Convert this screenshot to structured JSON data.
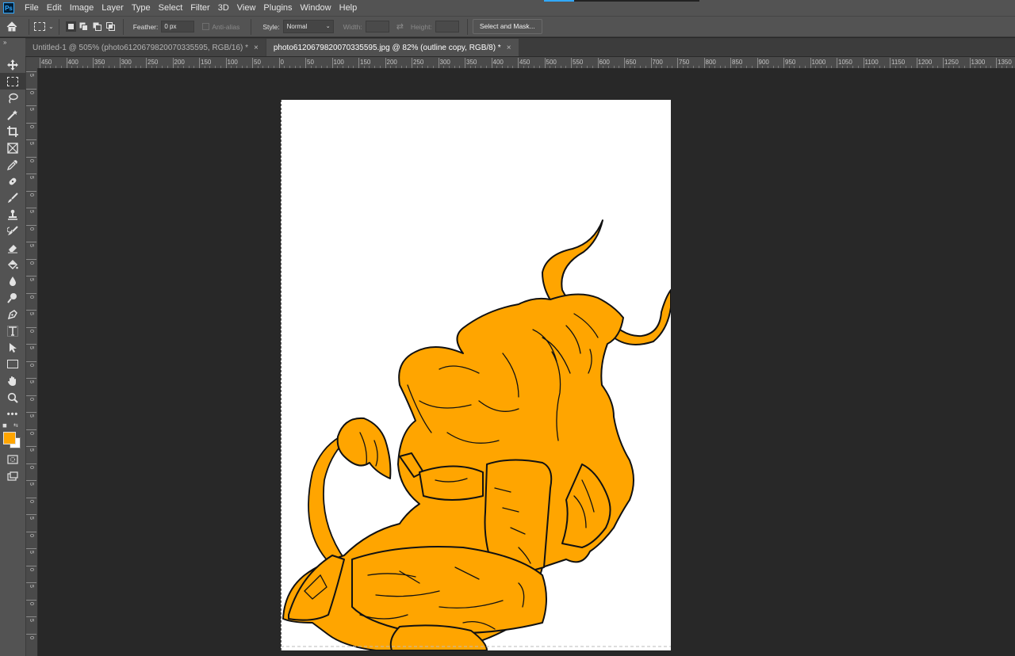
{
  "app": {
    "logo": "Ps"
  },
  "menu": [
    "File",
    "Edit",
    "Image",
    "Layer",
    "Type",
    "Select",
    "Filter",
    "3D",
    "View",
    "Plugins",
    "Window",
    "Help"
  ],
  "options": {
    "feather_label": "Feather:",
    "feather_value": "0 px",
    "antialias_label": "Anti-alias",
    "style_label": "Style:",
    "style_value": "Normal",
    "width_label": "Width:",
    "height_label": "Height:",
    "select_mask_label": "Select and Mask..."
  },
  "tabs": [
    {
      "label": "Untitled-1 @ 505% (photo6120679820070335595, RGB/16) *",
      "active": false
    },
    {
      "label": "photo6120679820070335595.jpg @ 82% (outline copy, RGB/8) *",
      "active": true
    }
  ],
  "tools": [
    "move-icon",
    "marquee-icon",
    "lasso-icon",
    "magic-wand-icon",
    "crop-icon",
    "frame-icon",
    "eyedropper-icon",
    "healing-brush-icon",
    "brush-icon",
    "clone-stamp-icon",
    "history-brush-icon",
    "eraser-icon",
    "paint-bucket-icon",
    "blur-icon",
    "dodge-icon",
    "pen-icon",
    "type-icon",
    "path-selection-icon",
    "rectangle-icon",
    "hand-icon",
    "zoom-icon",
    "more-tools-icon"
  ],
  "colors": {
    "foreground": "#ffa500",
    "background": "#ffffff",
    "accent": "#31a8ff"
  },
  "ruler": {
    "h_ticks": [
      "450",
      "400",
      "350",
      "300",
      "250",
      "200",
      "150",
      "100",
      "50",
      "0",
      "50",
      "100",
      "150",
      "200",
      "250",
      "300",
      "350",
      "400",
      "450",
      "500",
      "550",
      "600",
      "650",
      "700",
      "750",
      "800",
      "850",
      "900",
      "950",
      "1000",
      "1050",
      "1100",
      "1150",
      "1200",
      "1250",
      "1300",
      "1350"
    ],
    "v_ticks": [
      "5",
      "0",
      "5",
      "0",
      "5",
      "0",
      "5",
      "0",
      "5",
      "0",
      "5",
      "0",
      "5",
      "0",
      "5",
      "0",
      "5",
      "0",
      "5",
      "0",
      "5",
      "0",
      "5",
      "0",
      "5",
      "0",
      "5",
      "0",
      "5",
      "0",
      "5",
      "0",
      "5",
      "0"
    ]
  }
}
